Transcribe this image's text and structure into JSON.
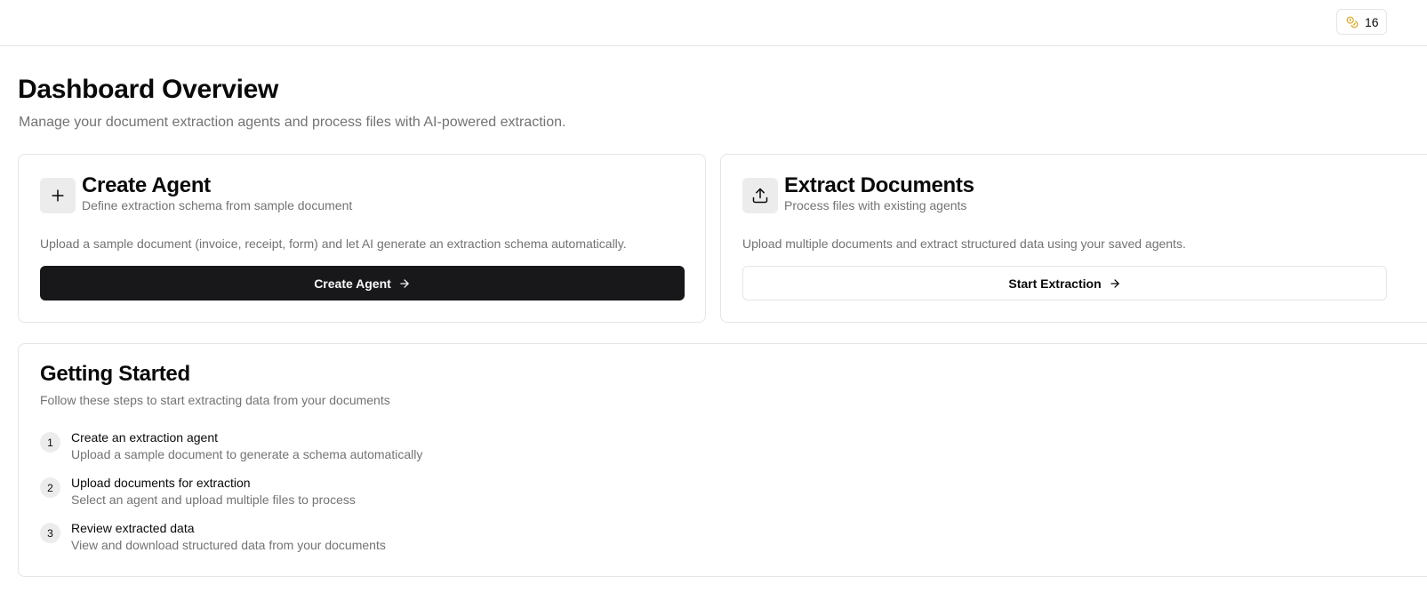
{
  "header": {
    "credits_count": "16",
    "credits_icon": "coins-icon",
    "accent_color": "#d9a520"
  },
  "page": {
    "title": "Dashboard Overview",
    "subtitle": "Manage your document extraction agents and process files with AI-powered extraction."
  },
  "cards": {
    "create_agent": {
      "icon": "plus-icon",
      "title": "Create Agent",
      "subtitle": "Define extraction schema from sample document",
      "description": "Upload a sample document (invoice, receipt, form) and let AI generate an extraction schema automatically.",
      "button_label": "Create Agent",
      "button_color": "#18181b"
    },
    "extract_documents": {
      "icon": "upload-icon",
      "title": "Extract Documents",
      "subtitle": "Process files with existing agents",
      "description": "Upload multiple documents and extract structured data using your saved agents.",
      "button_label": "Start Extraction"
    }
  },
  "getting_started": {
    "title": "Getting Started",
    "subtitle": "Follow these steps to start extracting data from your documents",
    "steps": [
      {
        "number": "1",
        "title": "Create an extraction agent",
        "description": "Upload a sample document to generate a schema automatically"
      },
      {
        "number": "2",
        "title": "Upload documents for extraction",
        "description": "Select an agent and upload multiple files to process"
      },
      {
        "number": "3",
        "title": "Review extracted data",
        "description": "View and download structured data from your documents"
      }
    ]
  }
}
